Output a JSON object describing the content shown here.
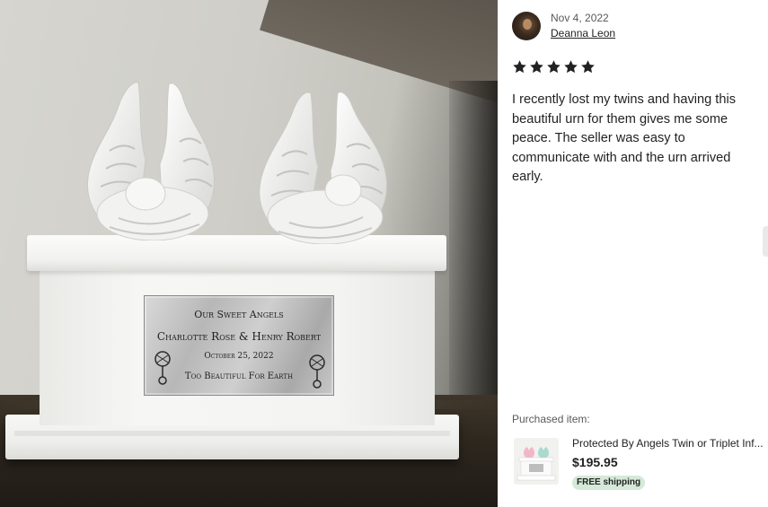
{
  "review": {
    "date": "Nov 4, 2022",
    "reviewer_name": "Deanna Leon",
    "rating": 5,
    "text": "I recently lost my twins and having this beautiful urn for them gives me some peace. The seller was easy to communicate with and the urn arrived early.",
    "star_color": "#222222"
  },
  "photo": {
    "plaque": {
      "line1": "Our Sweet Angels",
      "line2": "Charlotte Rose & Henry Robert",
      "line3": "October 25, 2022",
      "line4": "Too Beautiful For Earth"
    }
  },
  "purchase": {
    "label": "Purchased item:",
    "title": "Protected By Angels Twin or Triplet Inf...",
    "price": "$195.95",
    "shipping_badge": "FREE shipping",
    "badge_color": "#d4e9d7"
  }
}
